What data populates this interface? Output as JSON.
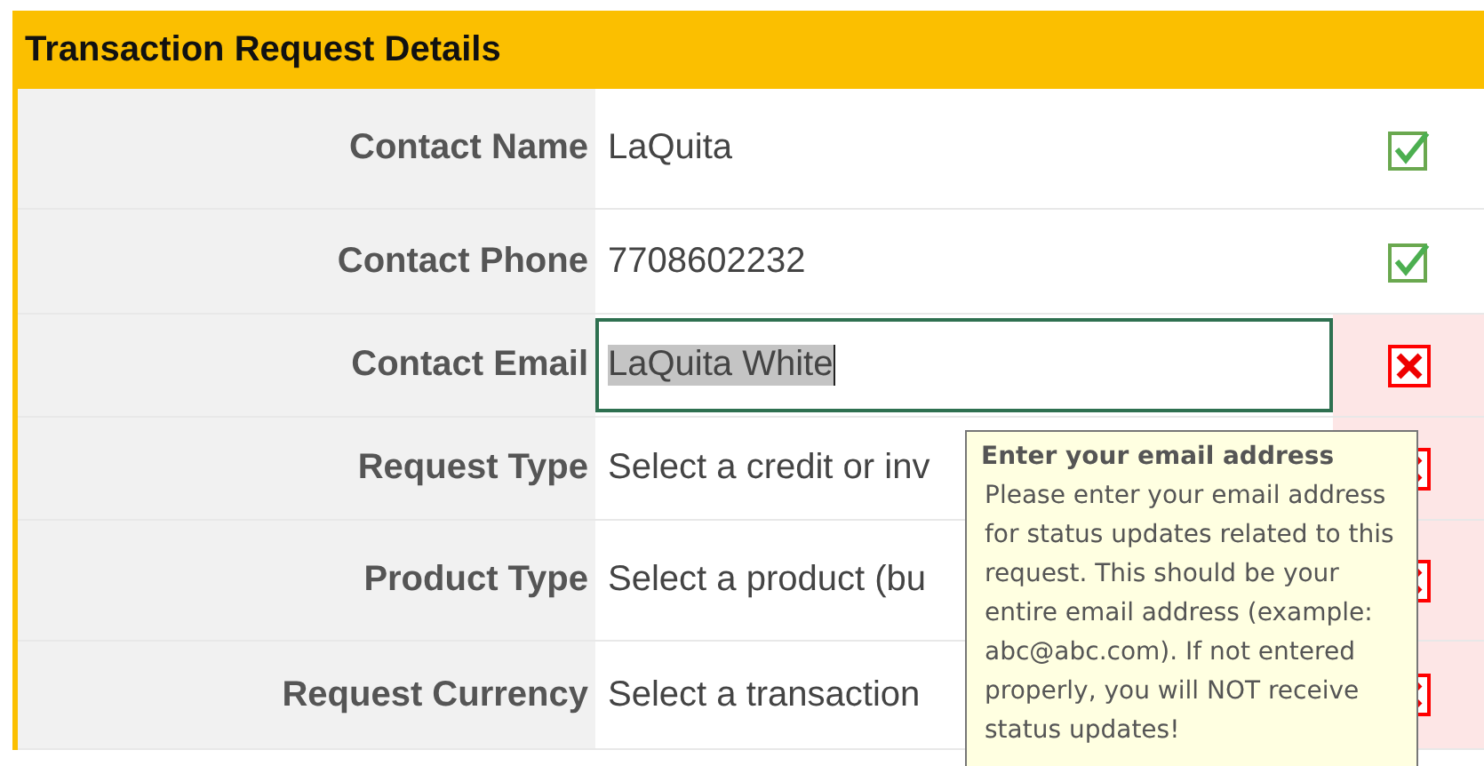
{
  "panel": {
    "title": "Transaction Request Details"
  },
  "rows": [
    {
      "label": "Contact Name",
      "value": "LaQuita",
      "valid": true,
      "focused": false
    },
    {
      "label": "Contact Phone",
      "value": "7708602232",
      "valid": true,
      "focused": false
    },
    {
      "label": "Contact Email",
      "value": "LaQuita White",
      "valid": false,
      "focused": true
    },
    {
      "label": "Request Type",
      "value": "Select a credit or inv",
      "valid": false,
      "focused": false
    },
    {
      "label": "Product Type",
      "value": "Select a product (bu",
      "valid": false,
      "focused": false
    },
    {
      "label": "Request Currency",
      "value": "Select a transaction",
      "valid": false,
      "focused": false
    }
  ],
  "tooltip": {
    "title": "Enter your email address",
    "body": "Please enter your email address for status updates related to this request. This should be your entire email address (example: abc@abc.com). If not entered properly, you will NOT receive status updates!"
  }
}
